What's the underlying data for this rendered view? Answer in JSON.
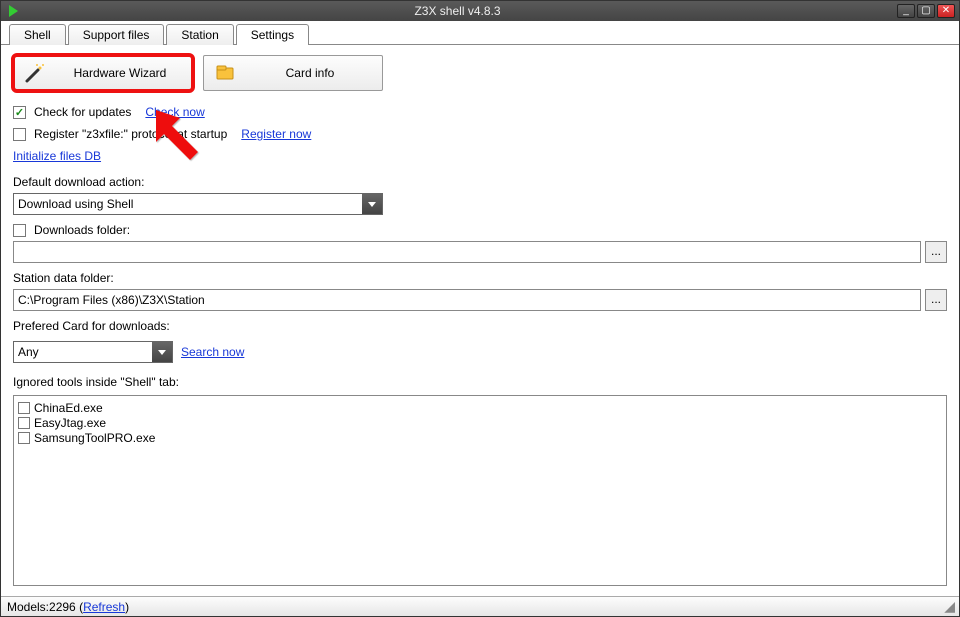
{
  "window": {
    "title": "Z3X shell v4.8.3"
  },
  "tabs": {
    "shell": "Shell",
    "support": "Support files",
    "station": "Station",
    "settings": "Settings"
  },
  "buttons": {
    "hardware_wizard": "Hardware Wizard",
    "card_info": "Card info",
    "browse": "..."
  },
  "checks": {
    "check_updates_label": "Check for updates",
    "register_protocol_label": "Register \"z3xfile:\" protocol at startup",
    "downloads_folder_label": "Downloads folder:"
  },
  "links": {
    "check_now": "Check now",
    "register_now": "Register now",
    "initialize_db": "Initialize files DB",
    "search_now": "Search now",
    "refresh": "Refresh"
  },
  "labels": {
    "default_action": "Default download action:",
    "station_folder": "Station data folder:",
    "preferred_card": "Prefered Card for downloads:",
    "ignored_tools": "Ignored tools inside \"Shell\" tab:"
  },
  "values": {
    "default_action": "Download using Shell",
    "downloads_folder": "",
    "station_folder": "C:\\Program Files (x86)\\Z3X\\Station",
    "preferred_card": "Any"
  },
  "ignored_tools": {
    "0": "ChinaEd.exe",
    "1": "EasyJtag.exe",
    "2": "SamsungToolPRO.exe"
  },
  "status": {
    "models_prefix": "Models: ",
    "models_count": "2296"
  }
}
